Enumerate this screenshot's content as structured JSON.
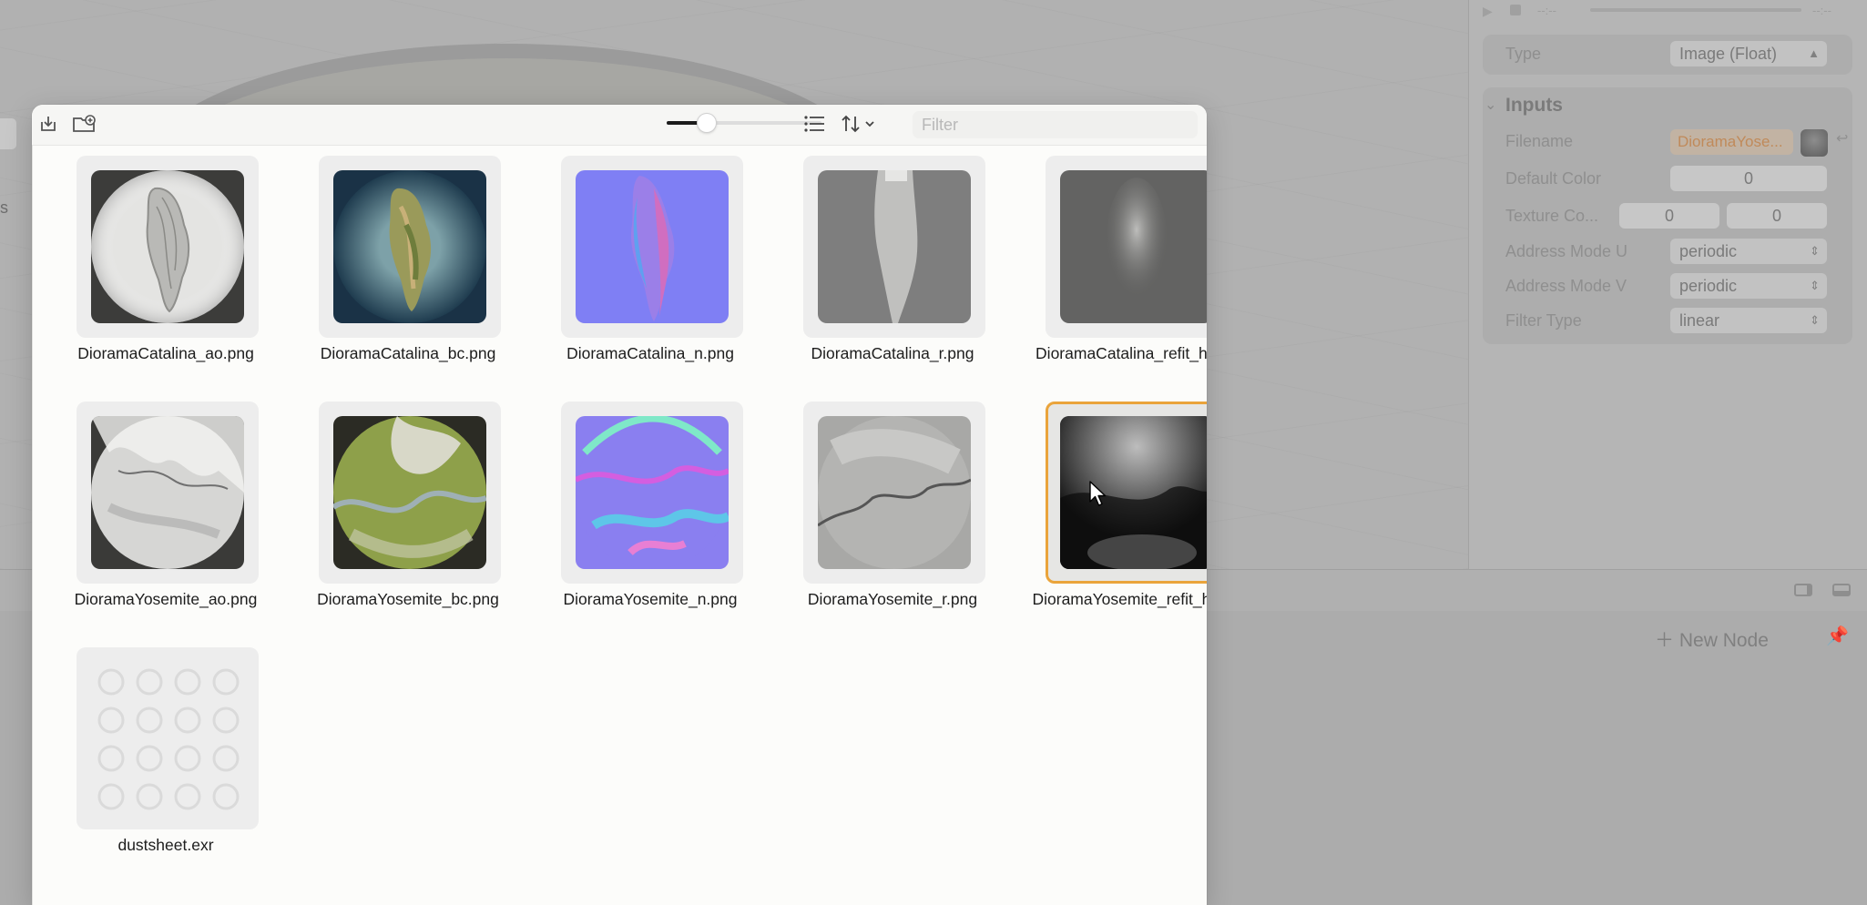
{
  "inspector": {
    "type_label": "Type",
    "type_value": "Image (Float)",
    "inputs_title": "Inputs",
    "filename_label": "Filename",
    "filename_value": "DioramaYose...",
    "default_color_label": "Default Color",
    "default_color_value": "0",
    "texture_coord_label": "Texture Co...",
    "texture_coord_u": "0",
    "texture_coord_v": "0",
    "address_u_label": "Address Mode U",
    "address_u_value": "periodic",
    "address_v_label": "Address Mode V",
    "address_v_value": "periodic",
    "filter_type_label": "Filter Type",
    "filter_type_value": "linear",
    "time_start": "--:--",
    "time_end": "--:--"
  },
  "node_editor": {
    "new_node_label": "New Node"
  },
  "background": {
    "left_fragment": "s"
  },
  "picker": {
    "filter_placeholder": "Filter",
    "zoom_fraction": 0.2,
    "selected_file": "DioramaYosemite_refit_h.exr",
    "files": [
      {
        "name": "DioramaCatalina_ao.png",
        "kind": "cat-ao"
      },
      {
        "name": "DioramaCatalina_bc.png",
        "kind": "cat-bc"
      },
      {
        "name": "DioramaCatalina_n.png",
        "kind": "cat-n"
      },
      {
        "name": "DioramaCatalina_r.png",
        "kind": "cat-r"
      },
      {
        "name": "DioramaCatalina_refit_h.exr",
        "kind": "cat-h"
      },
      {
        "name": "DioramaYosemite_ao.png",
        "kind": "yos-ao"
      },
      {
        "name": "DioramaYosemite_bc.png",
        "kind": "yos-bc"
      },
      {
        "name": "DioramaYosemite_n.png",
        "kind": "yos-n"
      },
      {
        "name": "DioramaYosemite_r.png",
        "kind": "yos-r"
      },
      {
        "name": "DioramaYosemite_refit_h.exr",
        "kind": "yos-h"
      },
      {
        "name": "dustsheet.exr",
        "kind": "dust"
      }
    ]
  }
}
